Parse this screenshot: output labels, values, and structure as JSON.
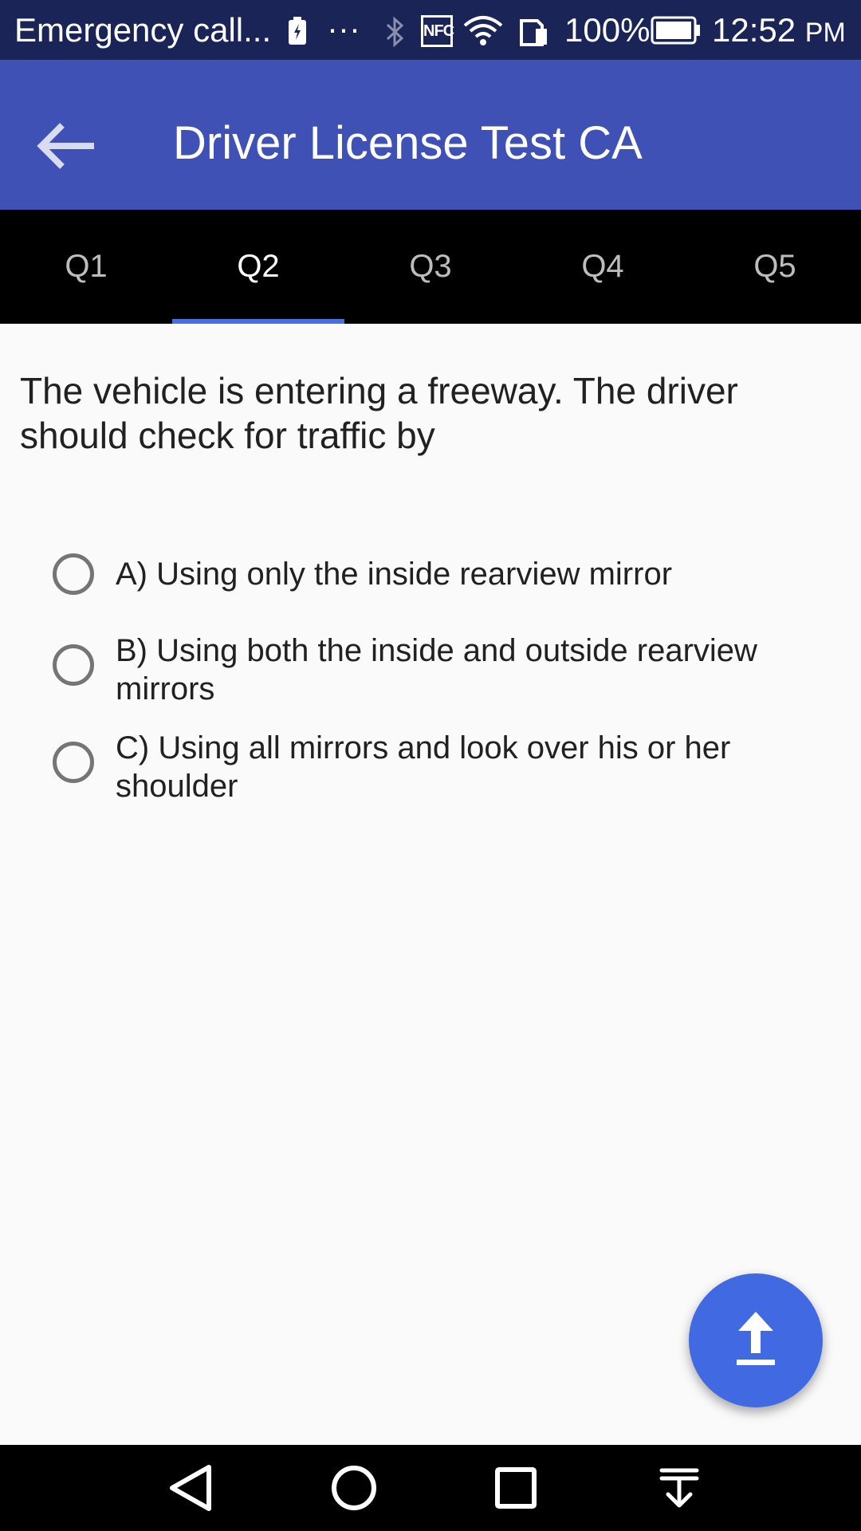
{
  "status_bar": {
    "notification": "Emergency call...",
    "more": "···",
    "nfc": "NFC",
    "battery_percent": "100%",
    "time": "12:52",
    "time_suffix": "PM",
    "icons": [
      "battery-saver-icon",
      "more-icon",
      "bluetooth-icon",
      "nfc-icon",
      "wifi-icon",
      "sim-icon",
      "battery-icon"
    ]
  },
  "app_bar": {
    "title": "Driver License Test CA",
    "back_icon": "arrow-left-icon",
    "color": "#3f51b5"
  },
  "tabs": [
    {
      "label": "Q1",
      "active": false
    },
    {
      "label": "Q2",
      "active": true
    },
    {
      "label": "Q3",
      "active": false
    },
    {
      "label": "Q4",
      "active": false
    },
    {
      "label": "Q5",
      "active": false
    }
  ],
  "question": {
    "text": "The vehicle is entering a freeway. The driver should check for traffic by",
    "options": [
      {
        "label": "A) Using only the inside rearview mirror",
        "selected": false
      },
      {
        "label": "B) Using both the inside and outside rearview mirrors",
        "selected": false
      },
      {
        "label": "C) Using all mirrors and look over his or her shoulder",
        "selected": false
      }
    ]
  },
  "fab": {
    "icon": "upload-icon",
    "color": "#4169e1"
  },
  "nav_bar": {
    "icons": [
      "back-triangle-icon",
      "home-circle-icon",
      "recents-square-icon",
      "notification-pulldown-icon"
    ]
  },
  "colors": {
    "status_bar": "#1a2456",
    "tab_bar": "#000000",
    "tab_indicator": "#4a6ee0",
    "background": "#fafafa"
  }
}
